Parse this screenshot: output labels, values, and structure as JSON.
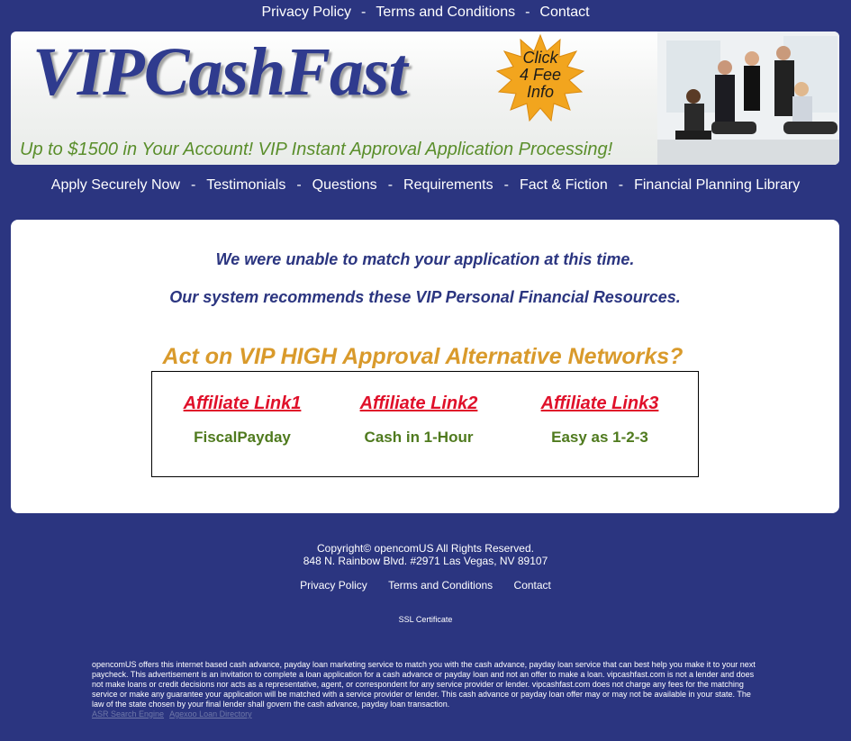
{
  "top_nav": {
    "privacy": "Privacy Policy",
    "terms": "Terms and Conditions",
    "contact": "Contact",
    "separator": "-"
  },
  "banner": {
    "logo": "VIPCashFast",
    "burst_line1": "Click",
    "burst_line2": "4 Fee",
    "burst_line3": "Info",
    "tagline": "Up to $1500 in Your Account! VIP Instant Approval Application Processing!"
  },
  "main_nav": {
    "items": [
      "Apply Securely Now",
      "Testimonials",
      "Questions",
      "Requirements",
      "Fact & Fiction",
      "Financial Planning Library"
    ],
    "separator": "-"
  },
  "main": {
    "message1": "We were unable to match your application at this time.",
    "message2": "Our system recommends these VIP Personal Financial Resources.",
    "act_heading": "Act on VIP HIGH Approval Alternative Networks?",
    "affiliates": [
      {
        "link": "Affiliate Link1",
        "name": "FiscalPayday"
      },
      {
        "link": "Affiliate Link2",
        "name": "Cash in 1-Hour"
      },
      {
        "link": "Affiliate Link3",
        "name": "Easy as 1-2-3"
      }
    ]
  },
  "footer": {
    "copyright": "Copyright© opencomUS All Rights Reserved.",
    "address": "848 N. Rainbow Blvd. #2971 Las Vegas, NV 89107",
    "privacy": "Privacy Policy",
    "terms": "Terms and Conditions",
    "contact": "Contact",
    "ssl": "SSL Certificate",
    "disclaimer": "opencomUS offers this internet based cash advance, payday loan marketing service to match you with the cash advance, payday loan service that can best help you make it to your next paycheck. This advertisement is an invitation to complete a loan application for a cash advance or payday loan and not an offer to make a loan. vipcashfast.com is not a lender and does not make loans or credit decisions nor acts as a representative, agent, or correspondent for any service provider or lender. vipcashfast.com does not charge any fees for the matching service or make any guarantee your application will be matched with a service provider or lender. This cash advance or payday loan offer may or may not be available in your state. The law of the state chosen by your final lender shall govern the cash advance, payday loan transaction.",
    "link1": "ASR Search Engine",
    "link2": "Agexoo Loan Directory"
  },
  "colors": {
    "background": "#2b3580",
    "accent_gold": "#d99a2b",
    "link_red": "#e0102a",
    "green": "#4f7a1e"
  }
}
